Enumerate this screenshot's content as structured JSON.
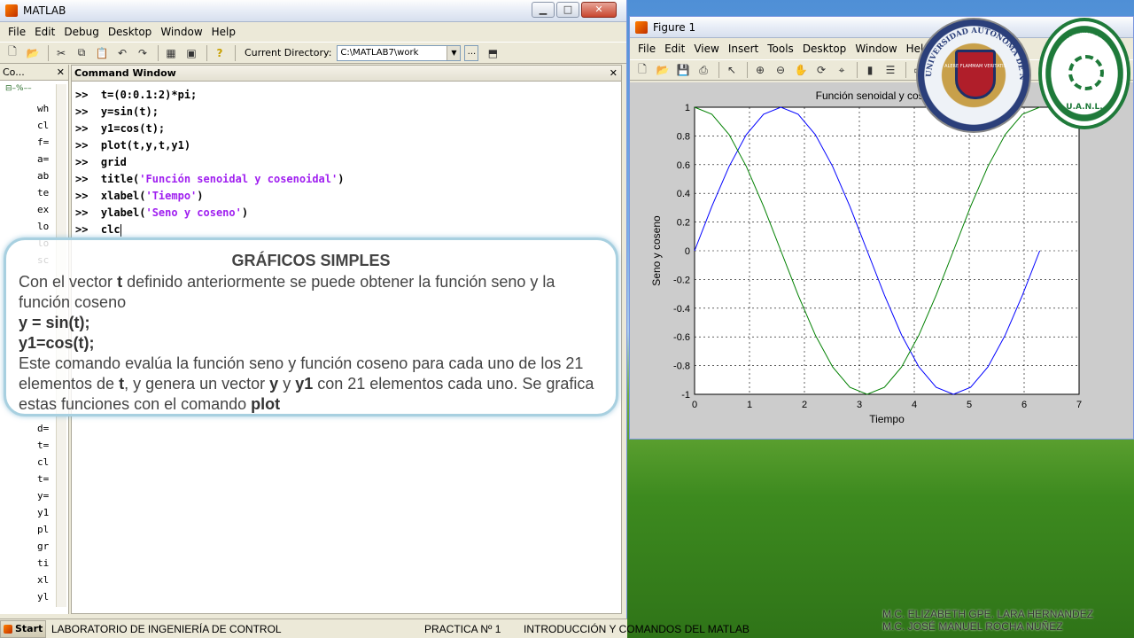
{
  "matlab": {
    "title": "MATLAB",
    "menu": [
      "File",
      "Edit",
      "Debug",
      "Desktop",
      "Window",
      "Help"
    ],
    "current_directory_label": "Current Directory:",
    "current_directory_value": "C:\\MATLAB7\\work",
    "browse_label": "...",
    "left_panel_title": "Co...",
    "left_items": [
      "wh",
      "cl",
      "f=",
      "a=",
      "ab",
      "te",
      "ex",
      "lo",
      "lo",
      "sc",
      "",
      "",
      "",
      "",
      "",
      "",
      "",
      "",
      "",
      "d=",
      "t=",
      "cl",
      "t=",
      "y=",
      "y1",
      "pl",
      "gr",
      "ti",
      "xl",
      "yl"
    ],
    "command_window_title": "Command Window",
    "command_prompt": ">>",
    "commands": [
      {
        "code": "t=(0:0.1:2)*pi;",
        "str": "",
        "after": ""
      },
      {
        "code": "y=sin(t);",
        "str": "",
        "after": ""
      },
      {
        "code": "y1=cos(t);",
        "str": "",
        "after": ""
      },
      {
        "code": "plot(t,y,t,y1)",
        "str": "",
        "after": ""
      },
      {
        "code": "grid",
        "str": "",
        "after": ""
      },
      {
        "code": "title(",
        "str": "'Función senoidal y cosenoidal'",
        "after": ")"
      },
      {
        "code": "xlabel(",
        "str": "'Tiempo'",
        "after": ")"
      },
      {
        "code": "ylabel(",
        "str": "'Seno y coseno'",
        "after": ")"
      },
      {
        "code": "clc",
        "str": "",
        "after": ""
      }
    ],
    "start_label": "Start",
    "status_lab": "LABORATORIO DE INGENIERÍA DE CONTROL",
    "status_practica": "PRACTICA Nº 1",
    "status_intro": "INTRODUCCIÓN Y COMANDOS DEL MATLAB"
  },
  "note": {
    "title": "GRÁFICOS SIMPLES",
    "line1_a": "Con el vector ",
    "line1_b": "t",
    "line1_c": " definido anteriormente se puede obtener la función seno y la función coseno",
    "code1": "y = sin(t);",
    "code2": "y1=cos(t);",
    "line2_a": "Este comando evalúa la función seno y función coseno para cada uno de los 21 elementos de ",
    "line2_b": "t",
    "line2_c": ", y genera un vector ",
    "line2_d": "y",
    "line2_e": " y ",
    "line2_f": "y1",
    "line2_g": " con 21 elementos cada uno. Se grafica estas funciones con el comando ",
    "line2_h": "plot"
  },
  "figure": {
    "title": "Figure 1",
    "menu": [
      "File",
      "Edit",
      "View",
      "Insert",
      "Tools",
      "Desktop",
      "Window",
      "Help"
    ]
  },
  "logos": {
    "uanl_ring": "UNIVERSIDAD AUTONOMA DE NUEVO LEON",
    "uanl_motto": "ALERE FLAMMAM VERITATIS",
    "fime_ring": "FACULTAD DE INGENIERÍA MECÁNICA Y ELÉCTRICA",
    "fime_text": "U.A.N.L."
  },
  "credits": {
    "line1": "M.C. ELIZABETH GPE. LARA HERNANDEZ",
    "line2": "M.C. JOSÉ MANUEL ROCHA NÚÑEZ"
  },
  "chart_data": {
    "type": "line",
    "title": "Función senoidal y cosenoidal",
    "xlabel": "Tiempo",
    "ylabel": "Seno y coseno",
    "xlim": [
      0,
      7
    ],
    "ylim": [
      -1,
      1
    ],
    "xticks": [
      0,
      1,
      2,
      3,
      4,
      5,
      6,
      7
    ],
    "yticks": [
      1,
      0.8,
      0.6,
      0.4,
      0.2,
      0,
      -0.2,
      -0.4,
      -0.6,
      -0.8,
      -1
    ],
    "grid": true,
    "x": [
      0,
      0.3142,
      0.6283,
      0.9425,
      1.2566,
      1.5708,
      1.885,
      2.1991,
      2.5133,
      2.8274,
      3.1416,
      3.4558,
      3.7699,
      4.0841,
      4.3982,
      4.7124,
      5.0265,
      5.3407,
      5.6549,
      5.969,
      6.2832
    ],
    "series": [
      {
        "color": "#0000ff",
        "values": [
          0,
          0.309,
          0.5878,
          0.809,
          0.9511,
          1,
          0.9511,
          0.809,
          0.5878,
          0.309,
          0,
          -0.309,
          -0.5878,
          -0.809,
          -0.9511,
          -1,
          -0.9511,
          -0.809,
          -0.5878,
          -0.309,
          0
        ]
      },
      {
        "color": "#008000",
        "values": [
          1,
          0.9511,
          0.809,
          0.5878,
          0.309,
          0,
          -0.309,
          -0.5878,
          -0.809,
          -0.9511,
          -1,
          -0.9511,
          -0.809,
          -0.5878,
          -0.309,
          0,
          0.309,
          0.5878,
          0.809,
          0.9511,
          1
        ]
      }
    ]
  }
}
